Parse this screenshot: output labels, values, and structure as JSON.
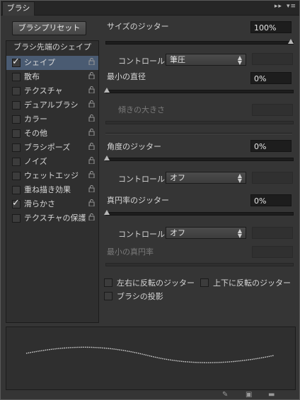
{
  "panel": {
    "tab_title": "ブラシ",
    "preset_button": "ブラシプリセット"
  },
  "sidebar": {
    "header": "ブラシ先端のシェイプ",
    "items": [
      {
        "label": "シェイプ",
        "checked": true,
        "selected": true
      },
      {
        "label": "散布",
        "checked": false
      },
      {
        "label": "テクスチャ",
        "checked": false
      },
      {
        "label": "デュアルブラシ",
        "checked": false
      },
      {
        "label": "カラー",
        "checked": false
      },
      {
        "label": "その他",
        "checked": false
      },
      {
        "label": "ブラシポーズ",
        "checked": false
      },
      {
        "label": "ノイズ",
        "checked": false
      },
      {
        "label": "ウェットエッジ",
        "checked": false
      },
      {
        "label": "重ね描き効果",
        "checked": false
      },
      {
        "label": "滑らかさ",
        "checked": true
      },
      {
        "label": "テクスチャの保護",
        "checked": false
      }
    ]
  },
  "settings": {
    "size_jitter_label": "サイズのジッター",
    "size_jitter_value": "100%",
    "control1_label": "コントロール：",
    "control1_value": "筆圧",
    "min_diameter_label": "最小の直径",
    "min_diameter_value": "0%",
    "tilt_scale_label": "傾きの大きさ",
    "angle_jitter_label": "角度のジッター",
    "angle_jitter_value": "0%",
    "control2_label": "コントロール：",
    "control2_value": "オフ",
    "roundness_jitter_label": "真円率のジッター",
    "roundness_jitter_value": "0%",
    "control3_label": "コントロール：",
    "control3_value": "オフ",
    "min_roundness_label": "最小の真円率",
    "flip_x_label": "左右に反転のジッター",
    "flip_y_label": "上下に反転のジッター",
    "projection_label": "ブラシの投影"
  },
  "colors": {
    "selected_row": "#4a5b72",
    "panel_bg": "#353535"
  }
}
